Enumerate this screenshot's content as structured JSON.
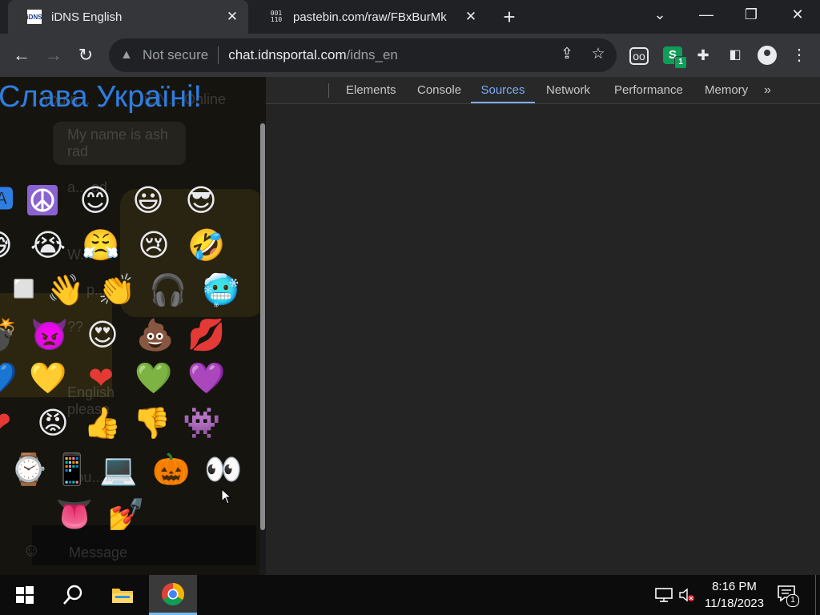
{
  "tabs": [
    {
      "title": "iDNS English",
      "favicon": "iDNS",
      "active": true
    },
    {
      "title": "pastebin.com/raw/FBxBurMk",
      "favicon": "001\n110",
      "active": false
    }
  ],
  "window_controls": {
    "dropdown": "⌄",
    "minimize": "—",
    "restore": "❐",
    "close": "✕"
  },
  "toolbar": {
    "security_label": "Not secure",
    "url_host": "chat.idnsportal.com",
    "url_path": "/idns_en",
    "extension_badge": "1"
  },
  "page": {
    "banner": "Слава Україні!",
    "ghost_texts": [
      "You n...",
      "iDN... Online",
      "My name is ash rad",
      "a... ad",
      "W... ou",
      "p...",
      "??",
      "English please",
      "You...",
      "Message"
    ],
    "emoji_rows": [
      [
        "🅰",
        "☮",
        "😊",
        "😃",
        "😎"
      ],
      [
        "😅",
        "😭",
        "😤",
        "😢",
        "🤣"
      ],
      [
        "⬜",
        "👋",
        "👏",
        "🎧",
        "🥶"
      ],
      [
        "💣",
        "👿",
        "😍",
        "💩",
        "💋"
      ],
      [
        "💙",
        "💛",
        "❤",
        "💚",
        "💜"
      ],
      [
        "❤",
        "😡",
        "👍",
        "👎",
        "👾"
      ],
      [
        "⌚",
        "📱",
        "💻",
        "🎃",
        "👀"
      ],
      [
        "",
        "👅",
        "💅",
        "",
        ""
      ]
    ]
  },
  "devtools": {
    "tabs": [
      "Elements",
      "Console",
      "Sources",
      "Network",
      "Performance",
      "Memory"
    ],
    "selected_tab": "Sources",
    "more": "»"
  },
  "taskbar": {
    "time": "8:16 PM",
    "date": "11/18/2023",
    "notification_count": "1"
  },
  "colors": {
    "accent": "#7cacf8",
    "banner": "#2f7de1",
    "chrome_dark": "#202124",
    "chrome_toolbar": "#35363a",
    "devtools_bg": "#242424"
  }
}
